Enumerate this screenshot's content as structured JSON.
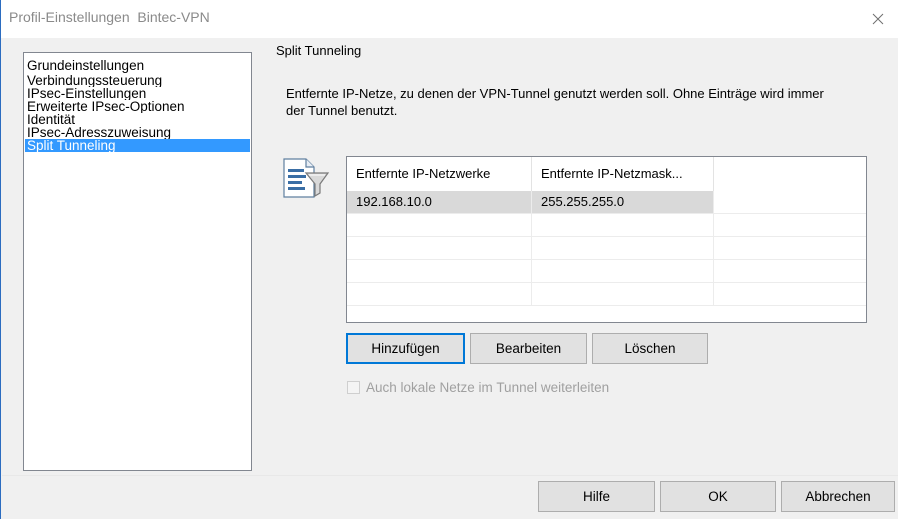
{
  "window": {
    "title": "Profil-Einstellungen  Bintec-VPN",
    "close_icon": "close-icon"
  },
  "nav": {
    "items": [
      {
        "label": "Grundeinstellungen",
        "selected": false
      },
      {
        "label": "Verbindungssteuerung",
        "selected": false
      },
      {
        "label": "IPsec-Einstellungen",
        "selected": false
      },
      {
        "label": "Erweiterte IPsec-Optionen",
        "selected": false
      },
      {
        "label": "Identität",
        "selected": false
      },
      {
        "label": "IPsec-Adresszuweisung",
        "selected": false
      },
      {
        "label": "Split Tunneling",
        "selected": true
      }
    ]
  },
  "section": {
    "title": "Split Tunneling",
    "description": "Entfernte IP-Netze, zu denen der VPN-Tunnel genutzt werden soll. Ohne Einträge wird immer der Tunnel benutzt.",
    "icon": "filter-list-icon"
  },
  "table": {
    "columns": [
      "Entfernte IP-Netzwerke",
      "Entfernte IP-Netzmask...",
      ""
    ],
    "rows": [
      [
        "192.168.10.0",
        "255.255.255.0",
        ""
      ],
      [
        "",
        "",
        ""
      ],
      [
        "",
        "",
        ""
      ],
      [
        "",
        "",
        ""
      ],
      [
        "",
        "",
        ""
      ]
    ],
    "selected_row": 0
  },
  "actions": {
    "add_label": "Hinzufügen",
    "edit_label": "Bearbeiten",
    "delete_label": "Löschen"
  },
  "options": {
    "local_networks_label": "Auch lokale Netze im Tunnel weiterleiten",
    "local_networks_checked": false,
    "local_networks_enabled": false
  },
  "footer": {
    "help_label": "Hilfe",
    "ok_label": "OK",
    "cancel_label": "Abbrechen"
  }
}
